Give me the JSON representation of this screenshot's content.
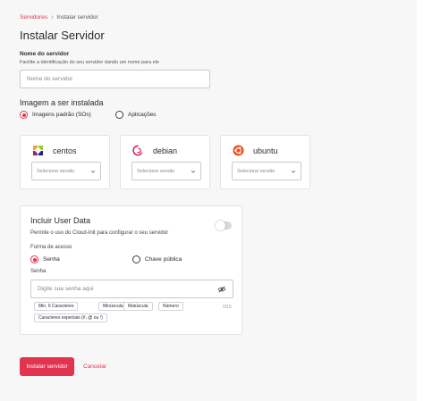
{
  "breadcrumb": {
    "parent": "Servidores",
    "separator": "›",
    "current": "Instalar servidor"
  },
  "page_title": "Instalar Servidor",
  "server_name": {
    "label": "Nome do servidor",
    "help": "Facilite a identificação do seu servidor dando um nome para ele",
    "placeholder": "Nome do servidor",
    "value": ""
  },
  "image": {
    "title": "Imagem a ser instalada",
    "options": [
      {
        "label": "Imagens padrão (SOs)",
        "selected": true
      },
      {
        "label": "Aplicações",
        "selected": false
      }
    ],
    "os_cards": [
      {
        "name": "centos",
        "icon": "centos-logo-icon",
        "select_placeholder": "Selecione versão"
      },
      {
        "name": "debian",
        "icon": "debian-logo-icon",
        "select_placeholder": "Selecione versão"
      },
      {
        "name": "ubuntu",
        "icon": "ubuntu-logo-icon",
        "select_placeholder": "Selecione versão"
      }
    ]
  },
  "user_data": {
    "title": "Incluir User Data",
    "description": "Permite o uso do Cloud-Init para configurar o seu servidor",
    "toggle_on": false,
    "access_label": "Forma de acesso",
    "access_options": [
      {
        "label": "Senha",
        "selected": true
      },
      {
        "label": "Chave pública",
        "selected": false
      }
    ],
    "password_label": "Senha",
    "password_placeholder": "Digite sua senha aqui",
    "counter": "0/15",
    "requirements": [
      "Min. 6 Caracteres",
      "Minúscula",
      "Maiúscula",
      "Número",
      "Caracteres especiais (#, @ ou !)"
    ]
  },
  "actions": {
    "submit": "Instalar servidor",
    "cancel": "Cancelar"
  },
  "colors": {
    "accent": "#e3344f",
    "background": "#f7f7f8"
  }
}
